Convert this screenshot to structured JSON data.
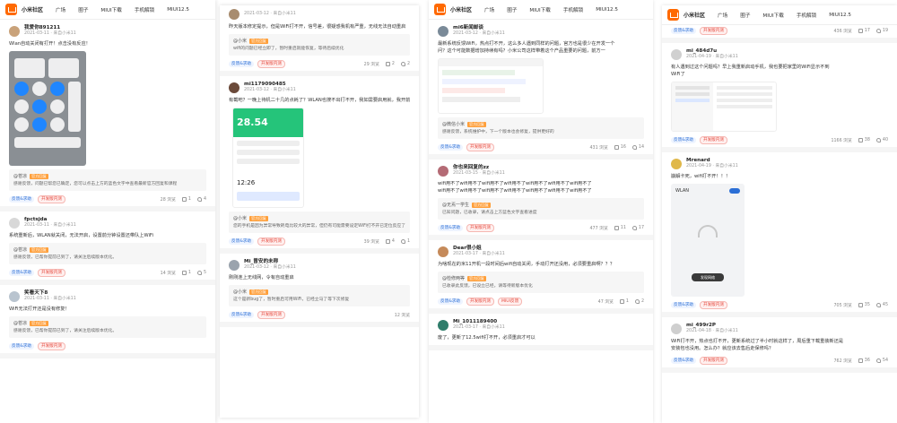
{
  "nav": {
    "brand": "小米社区",
    "items": [
      "广场",
      "圈子",
      "MIUI下载",
      "手机解锁",
      "MIUI12.5"
    ]
  },
  "colors": {
    "accent": "#ff6900",
    "tag_blue": "#2c6fd6",
    "tag_red": "#e5483c",
    "badge": "#ff9f3a"
  },
  "p1": {
    "posts": [
      {
        "user": "我爱你891211",
        "meta": "2021-03-11 · 来自小米11",
        "text": "Wlan自动关闭有打开！点击没有反应！",
        "reply": {
          "name": "@苍凉",
          "badge": "官方回复",
          "text": "感谢反馈，问题已帮您已确定，您可以点击上方的蓝色文字中查看最新官方回复和课程"
        },
        "tags": [
          "反馈&求助",
          "开发版内测"
        ],
        "views": "28 浏览",
        "comments": "1",
        "likes": "4"
      },
      {
        "user": "fpctsjda",
        "meta": "2021-03-11 · 来自小米11",
        "text": "系统重新后，WLAN就关闭，无法开启，设置前分钟设置还带队上WiFi",
        "reply": {
          "name": "@苍凉",
          "badge": "官方回复",
          "text": "感谢反馈，已帮你提前已到了，请关注后续版本优化。"
        },
        "tags": [
          "反馈&求助",
          "开发版内测"
        ],
        "views": "14 浏览",
        "comments": "1",
        "likes": "5"
      },
      {
        "user": "笑看天下8",
        "meta": "2021-03-11 · 来自小米11",
        "text": "WiFi无法打开还是没有修复！",
        "reply": {
          "name": "@苍凉",
          "badge": "官方回复",
          "text": "感谢反馈，已帮你提前已到了，请关注后续版本优化。"
        },
        "tags": [
          "反馈&求助",
          "开发版内测"
        ],
        "views": "",
        "comments": "",
        "likes": ""
      }
    ]
  },
  "p2": {
    "posts": [
      {
        "user": "",
        "meta": "2021-03-12 · 来自小米11",
        "text": "昨天版本修定提示，但是WiFi打不开，信号差，很疑惑我机有严重，无线无法自动重启",
        "reply": {
          "name": "@小米",
          "badge": "官方回复",
          "text": "wifi的问题已经立即了，暂时重启就能恢复，等待后续优化"
        },
        "tags": [
          "反馈&求助",
          "开发版内测"
        ],
        "views": "29 浏览",
        "comments": "2",
        "likes": "2"
      },
      {
        "user": "mi1179090485",
        "meta": "2021-03-12 · 来自小米11",
        "text": "有截吧？一晚上待机二十几的点耗了？WLAN也搜不出打不开，我如需要启用就，我开前天关注，但原本一件事重复启手机吧？",
        "reply": {
          "name": "@小米",
          "badge": "官方回复",
          "text": "您的手机是因为异常导致耗电比较大的异常，但仍有可能需要设定WiFi打不开已定位反应了，暂时可能需要重启一下，等待更新发布修复"
        },
        "phone": {
          "battery": "28.54",
          "time": "12:26"
        },
        "tags": [
          "反馈&求助",
          "开发版内测"
        ],
        "views": "39 浏览",
        "comments": "4",
        "likes": "1"
      },
      {
        "user": "Mi_曾安的未称",
        "meta": "2021-03-12 · 来自小米11",
        "text": "刚刚连上无线网，令有自动重启",
        "reply": {
          "name": "@小米",
          "badge": "官方回复",
          "text": "这个是新bug了，暂时重启可用WiFi，已经立马了等下次修复"
        },
        "tags": [
          "反馈&求助",
          "开发版内测"
        ],
        "views": "12 浏览",
        "comments": "",
        "likes": ""
      }
    ]
  },
  "p3": {
    "posts": [
      {
        "user": "mi6新闻邮谈",
        "meta": "2021-03-12 · 来自小米11",
        "text": "最新系统反馈WiFi，热点打不开，这么多人遇到同样的问题，官方也是很少在开发一个",
        "text2": "问？这个可能数据增加持续有吗？小米公司这样带着这个产品重要的问题，前方一",
        "reply": {
          "name": "@微信小米",
          "badge": "官方回复",
          "text": "感谢反馈，系统维护中，下一个版本也会修复，提供更好的"
        },
        "tags": [
          "反馈&求助",
          "开发版内测"
        ],
        "views": "431 浏览",
        "comments": "16",
        "likes": "14"
      },
      {
        "user": "你也来回复的zz",
        "meta": "2021-03-15 · 来自小米11",
        "text": "wifi用不了wifi用不了wifi用不了wifi用不了wifi用不了wifi用不了wifi用不了",
        "text2": "wifi用不了wifi用不了wifi用不了wifi用不了wifi用不了wifi用不了wifi用不了",
        "reply": {
          "name": "@无焉一学生",
          "badge": "官方回复",
          "text": "已知问题，已收录，请点击上方蓝色文字查看进度"
        },
        "tags": [
          "反馈&求助",
          "开发版内测"
        ],
        "views": "477 浏览",
        "comments": "11",
        "likes": "17"
      },
      {
        "user": "Dear很小姐",
        "meta": "2021-03-17 · 来自小米11",
        "text": "为啥现在的米11开机一段时间后wifi自动关闭，手动打开还没用，必须要重启啊？？？",
        "reply": {
          "name": "@检修两等",
          "badge": "官方回复",
          "text": "已收录此反馈，已设立已经，请等待新版本优化"
        },
        "tags": [
          "反馈&求助",
          "开发版内测",
          "MIUI反馈"
        ],
        "views": "47 浏览",
        "comments": "1",
        "likes": "2"
      },
      {
        "user": "Mi_1011189400",
        "meta": "2021-03-17 · 来自小米11",
        "text": "废了，更新了12.5wifi打不开，必须重启才可以",
        "tags": [],
        "views": "",
        "comments": "",
        "likes": ""
      }
    ]
  },
  "p4": {
    "top": {
      "tags": [
        "反馈&求助",
        "开发版内测"
      ],
      "views": "436 浏览",
      "comments": "17",
      "likes": "19"
    },
    "posts": [
      {
        "user": "mi_484d7u",
        "meta": "2021-04-19 · 来自小米11",
        "text": "有人遇到过这个问题吗？早上我重新启动手机，我也要把家里的WiFi显示不到",
        "text2": "WiFi了",
        "tags": [
          "反馈&求助",
          "开发版内测"
        ],
        "views": "1166 浏览",
        "comments": "38",
        "likes": "40"
      },
      {
        "user": "Mrenard",
        "meta": "2021-04-19 · 来自小米11",
        "text": "崩解卡死，wifi打不开！！！",
        "wlan": {
          "title": "WLAN",
          "button": "发现网络"
        },
        "tags": [
          "反馈&求助",
          "开发版内测"
        ],
        "views": "705 浏览",
        "comments": "35",
        "likes": "45"
      },
      {
        "user": "mi_499r2P",
        "meta": "2021-04-18 · 来自小米11",
        "text": "WiFi打不开，热点也打不开，更新系统过了半小时就这样了，周后重下载重装新还是",
        "text2": "安装包也没用。怎么办？就应该去售后走保修吗？",
        "tags": [
          "反馈&求助",
          "开发版内测"
        ],
        "views": "762 浏览",
        "comments": "36",
        "likes": "54"
      }
    ]
  }
}
